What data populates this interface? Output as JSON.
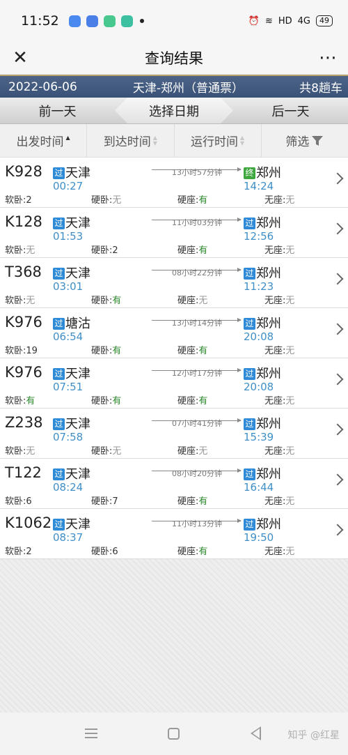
{
  "status_bar": {
    "time": "11:52",
    "network": "HD",
    "signal": "4G",
    "battery": "49"
  },
  "header": {
    "title": "查询结果",
    "close_icon": "close-icon",
    "more_icon": "more-icon"
  },
  "info": {
    "date": "2022-06-06",
    "route": "天津-郑州（普通票）",
    "count": "共8趟车"
  },
  "date_nav": {
    "prev": "前一天",
    "select": "选择日期",
    "next": "后一天"
  },
  "sort": {
    "depart": "出发时间",
    "arrive": "到达时间",
    "duration": "运行时间",
    "filter": "筛选"
  },
  "seat_labels": {
    "soft_sleeper": "软卧:",
    "hard_sleeper": "硬卧:",
    "hard_seat": "硬座:",
    "no_seat": "无座:"
  },
  "trains": [
    {
      "no": "K928",
      "from_tag": "过",
      "from": "天津",
      "dep": "00:27",
      "duration": "13小时57分钟",
      "to_tag": "终",
      "to_end": true,
      "to": "郑州",
      "arr": "14:24",
      "soft": "2",
      "hard_sleep": "无",
      "hard_seat": "有",
      "no_seat": "无"
    },
    {
      "no": "K128",
      "from_tag": "过",
      "from": "天津",
      "dep": "01:53",
      "duration": "11小时03分钟",
      "to_tag": "过",
      "to_end": false,
      "to": "郑州",
      "arr": "12:56",
      "soft": "无",
      "hard_sleep": "2",
      "hard_seat": "有",
      "no_seat": "无"
    },
    {
      "no": "T368",
      "from_tag": "过",
      "from": "天津",
      "dep": "03:01",
      "duration": "08小时22分钟",
      "to_tag": "过",
      "to_end": false,
      "to": "郑州",
      "arr": "11:23",
      "soft": "无",
      "hard_sleep": "有",
      "hard_seat": "无",
      "no_seat": "无"
    },
    {
      "no": "K976",
      "from_tag": "过",
      "from": "塘沽",
      "dep": "06:54",
      "duration": "13小时14分钟",
      "to_tag": "过",
      "to_end": false,
      "to": "郑州",
      "arr": "20:08",
      "soft": "19",
      "hard_sleep": "有",
      "hard_seat": "有",
      "no_seat": "无"
    },
    {
      "no": "K976",
      "from_tag": "过",
      "from": "天津",
      "dep": "07:51",
      "duration": "12小时17分钟",
      "to_tag": "过",
      "to_end": false,
      "to": "郑州",
      "arr": "20:08",
      "soft": "有",
      "hard_sleep": "有",
      "hard_seat": "有",
      "no_seat": "无"
    },
    {
      "no": "Z238",
      "from_tag": "过",
      "from": "天津",
      "dep": "07:58",
      "duration": "07小时41分钟",
      "to_tag": "过",
      "to_end": false,
      "to": "郑州",
      "arr": "15:39",
      "soft": "无",
      "hard_sleep": "无",
      "hard_seat": "无",
      "no_seat": "无"
    },
    {
      "no": "T122",
      "from_tag": "过",
      "from": "天津",
      "dep": "08:24",
      "duration": "08小时20分钟",
      "to_tag": "过",
      "to_end": false,
      "to": "郑州",
      "arr": "16:44",
      "soft": "6",
      "hard_sleep": "7",
      "hard_seat": "有",
      "no_seat": "无"
    },
    {
      "no": "K1062",
      "from_tag": "过",
      "from": "天津",
      "dep": "08:37",
      "duration": "11小时13分钟",
      "to_tag": "过",
      "to_end": false,
      "to": "郑州",
      "arr": "19:50",
      "soft": "2",
      "hard_sleep": "6",
      "hard_seat": "有",
      "no_seat": "无"
    }
  ],
  "watermark": "知乎 @红星",
  "colors": {
    "accent": "#3f8fc7",
    "info_bar": "#3b5278",
    "available": "#2e8b2e",
    "tag_pass": "#2f8bd8",
    "tag_end": "#3ea83e"
  }
}
